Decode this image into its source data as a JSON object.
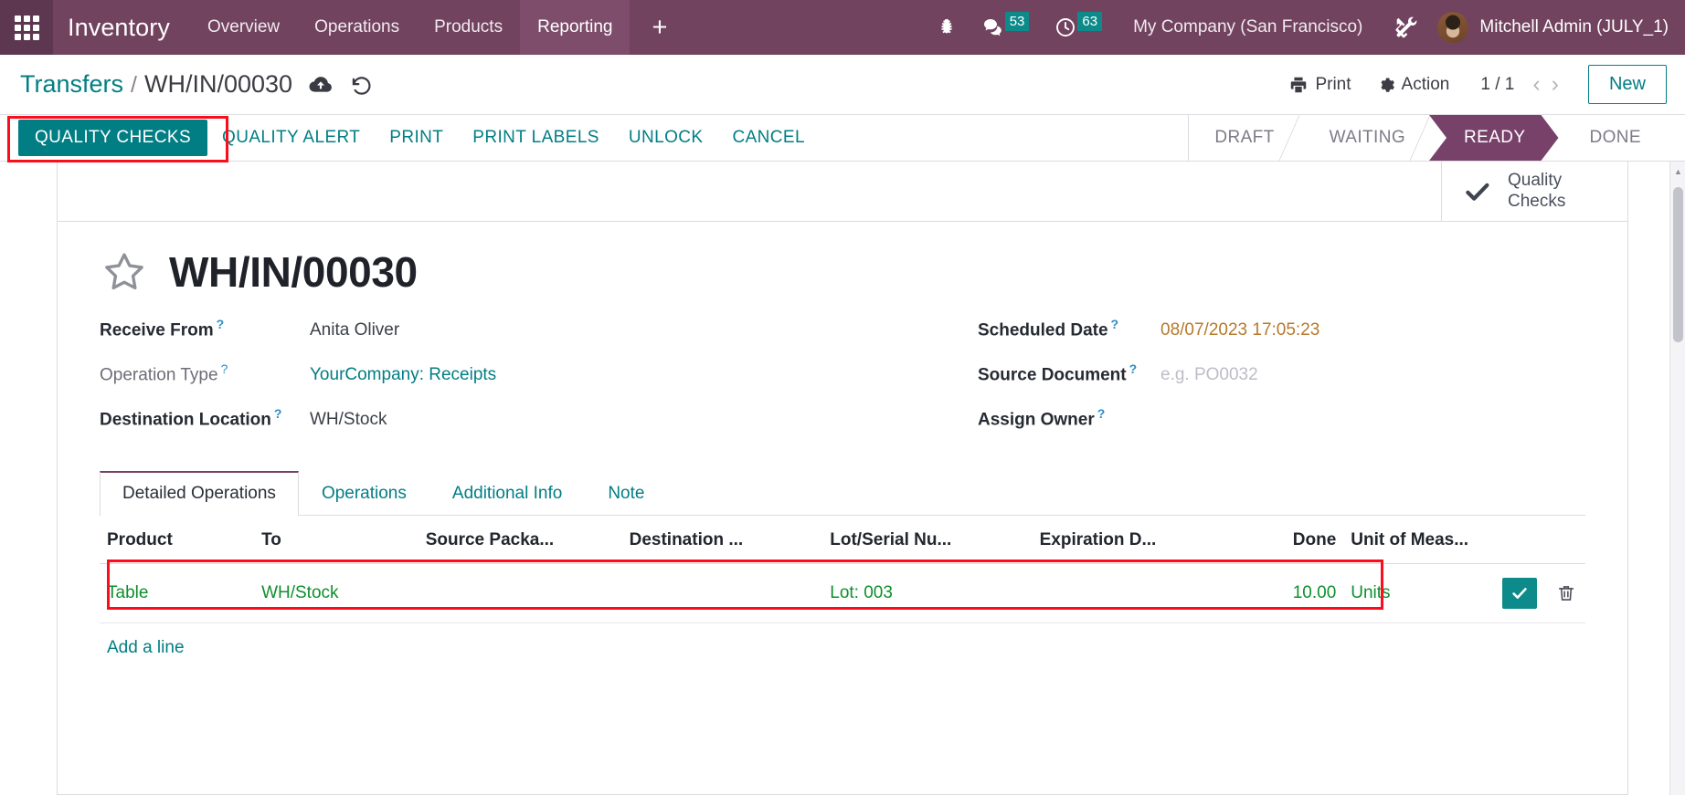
{
  "navbar": {
    "apps_icon": "grid-apps-icon",
    "brand": "Inventory",
    "menus": [
      {
        "label": "Overview",
        "active": false
      },
      {
        "label": "Operations",
        "active": false
      },
      {
        "label": "Products",
        "active": false
      },
      {
        "label": "Reporting",
        "active": true
      }
    ],
    "plus_label": "+",
    "debug_icon": "bug-icon",
    "messages": {
      "icon": "chat-bubble-icon",
      "count": "53"
    },
    "activities": {
      "icon": "clock-icon",
      "count": "63"
    },
    "company": "My Company (San Francisco)",
    "settings_icon": "tools-icon",
    "user": {
      "avatar": "user-avatar",
      "name": "Mitchell Admin (JULY_1)"
    }
  },
  "control_panel": {
    "breadcrumb_parent": "Transfers",
    "breadcrumb_separator": "/",
    "breadcrumb_current": "WH/IN/00030",
    "save_icon": "cloud-upload-icon",
    "discard_icon": "undo-icon",
    "print_label": "Print",
    "action_label": "Action",
    "pager": "1 / 1",
    "prev_icon": "chevron-left-icon",
    "next_icon": "chevron-right-icon",
    "new_label": "New"
  },
  "button_bar": {
    "buttons": [
      {
        "label": "QUALITY CHECKS",
        "primary": true,
        "highlighted": true
      },
      {
        "label": "QUALITY ALERT",
        "primary": false,
        "highlighted": false
      },
      {
        "label": "PRINT",
        "primary": false,
        "highlighted": false
      },
      {
        "label": "PRINT LABELS",
        "primary": false,
        "highlighted": false
      },
      {
        "label": "UNLOCK",
        "primary": false,
        "highlighted": false
      },
      {
        "label": "CANCEL",
        "primary": false,
        "highlighted": false
      }
    ],
    "statusbar": [
      {
        "label": "DRAFT",
        "active": false
      },
      {
        "label": "WAITING",
        "active": false
      },
      {
        "label": "READY",
        "active": true
      },
      {
        "label": "DONE",
        "active": false
      }
    ]
  },
  "smart_buttons": [
    {
      "icon": "check-icon",
      "label_line1": "Quality",
      "label_line2": "Checks"
    }
  ],
  "form": {
    "favorite_icon": "star-outline-icon",
    "title": "WH/IN/00030",
    "left_fields": [
      {
        "label": "Receive From",
        "help": "?",
        "value": "Anita Oliver",
        "style": "strong",
        "value_style": "text"
      },
      {
        "label": "Operation Type",
        "help": "?",
        "value": "YourCompany: Receipts",
        "style": "muted",
        "value_style": "link"
      },
      {
        "label": "Destination Location",
        "help": "?",
        "value": "WH/Stock",
        "style": "strong",
        "value_style": "text"
      }
    ],
    "right_fields": [
      {
        "label": "Scheduled Date",
        "help": "?",
        "value": "08/07/2023 17:05:23",
        "style": "strong",
        "value_style": "date"
      },
      {
        "label": "Source Document",
        "help": "?",
        "value": "e.g. PO0032",
        "style": "strong",
        "value_style": "placeholder"
      },
      {
        "label": "Assign Owner",
        "help": "?",
        "value": "",
        "style": "strong",
        "value_style": "text"
      }
    ]
  },
  "notebook": {
    "tabs": [
      {
        "label": "Detailed Operations",
        "active": true
      },
      {
        "label": "Operations",
        "active": false
      },
      {
        "label": "Additional Info",
        "active": false
      },
      {
        "label": "Note",
        "active": false
      }
    ]
  },
  "list": {
    "columns": [
      "Product",
      "To",
      "Source Packa...",
      "Destination ...",
      "Lot/Serial Nu...",
      "Expiration D...",
      "Done",
      "Unit of Meas..."
    ],
    "rows": [
      {
        "product": "Table",
        "to": "WH/Stock",
        "source_package": "",
        "destination_package": "",
        "lot_serial": "Lot: 003",
        "expiration_date": "",
        "done": "10.00",
        "uom": "Units",
        "confirm_icon": "check-icon",
        "delete_icon": "trash-icon",
        "highlighted": true
      }
    ],
    "add_line_label": "Add a line"
  },
  "colors": {
    "brand_purple": "#71435f",
    "accent_teal": "#017e84",
    "badge_teal": "#0d8a8a",
    "status_active": "#77416a",
    "annotation_red": "#fc0d1b",
    "row_green": "#0e8f2e",
    "date_amber": "#b5792b"
  }
}
